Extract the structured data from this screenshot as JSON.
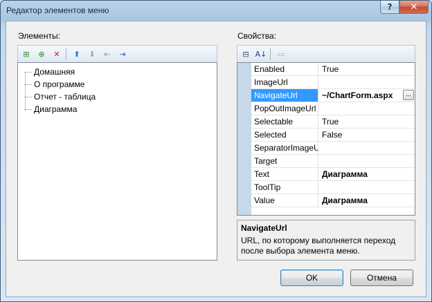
{
  "window": {
    "title": "Редактор элементов меню",
    "help_glyph": "?",
    "close_glyph": "✕"
  },
  "elements_panel": {
    "label": "Элементы:",
    "toolbar": [
      {
        "name": "add-root-item",
        "glyph": "⊞",
        "color": "#2d8a2d"
      },
      {
        "name": "add-child-item",
        "glyph": "⊕",
        "color": "#2d8a2d"
      },
      {
        "name": "delete-item",
        "glyph": "✕",
        "color": "#d02020"
      },
      {
        "name": "move-up",
        "glyph": "⬆",
        "color": "#2a6fd0"
      },
      {
        "name": "move-down",
        "glyph": "⬇",
        "color": "#9aa5b0"
      },
      {
        "name": "outdent",
        "glyph": "⇤",
        "color": "#9aa5b0"
      },
      {
        "name": "indent",
        "glyph": "⇥",
        "color": "#2a6fd0"
      }
    ],
    "items": [
      "Домашняя",
      "О программе",
      "Отчет - таблица",
      "Диаграмма"
    ]
  },
  "properties_panel": {
    "label": "Свойства:",
    "toolbar": [
      {
        "name": "categorized",
        "glyph": "⊟",
        "color": "#2a4a6a"
      },
      {
        "name": "alphabetical",
        "glyph": "A↓",
        "color": "#1a3a8a"
      },
      {
        "name": "property-pages",
        "glyph": "▭",
        "color": "#9aa5b0"
      }
    ],
    "rows": [
      {
        "name": "Enabled",
        "value": "True",
        "bold": false
      },
      {
        "name": "ImageUrl",
        "value": "",
        "bold": false
      },
      {
        "name": "NavigateUrl",
        "value": "~/ChartForm.aspx",
        "bold": true,
        "selected": true,
        "ellipsis": "..."
      },
      {
        "name": "PopOutImageUrl",
        "value": "",
        "bold": false
      },
      {
        "name": "Selectable",
        "value": "True",
        "bold": false
      },
      {
        "name": "Selected",
        "value": "False",
        "bold": false
      },
      {
        "name": "SeparatorImageUrl",
        "value": "",
        "bold": false
      },
      {
        "name": "Target",
        "value": "",
        "bold": false
      },
      {
        "name": "Text",
        "value": "Диаграмма",
        "bold": true
      },
      {
        "name": "ToolTip",
        "value": "",
        "bold": false
      },
      {
        "name": "Value",
        "value": "Диаграмма",
        "bold": true
      }
    ],
    "description": {
      "title": "NavigateUrl",
      "text": "URL, по которому выполняется переход после выбора элемента меню."
    }
  },
  "buttons": {
    "ok": "OK",
    "cancel": "Отмена"
  }
}
